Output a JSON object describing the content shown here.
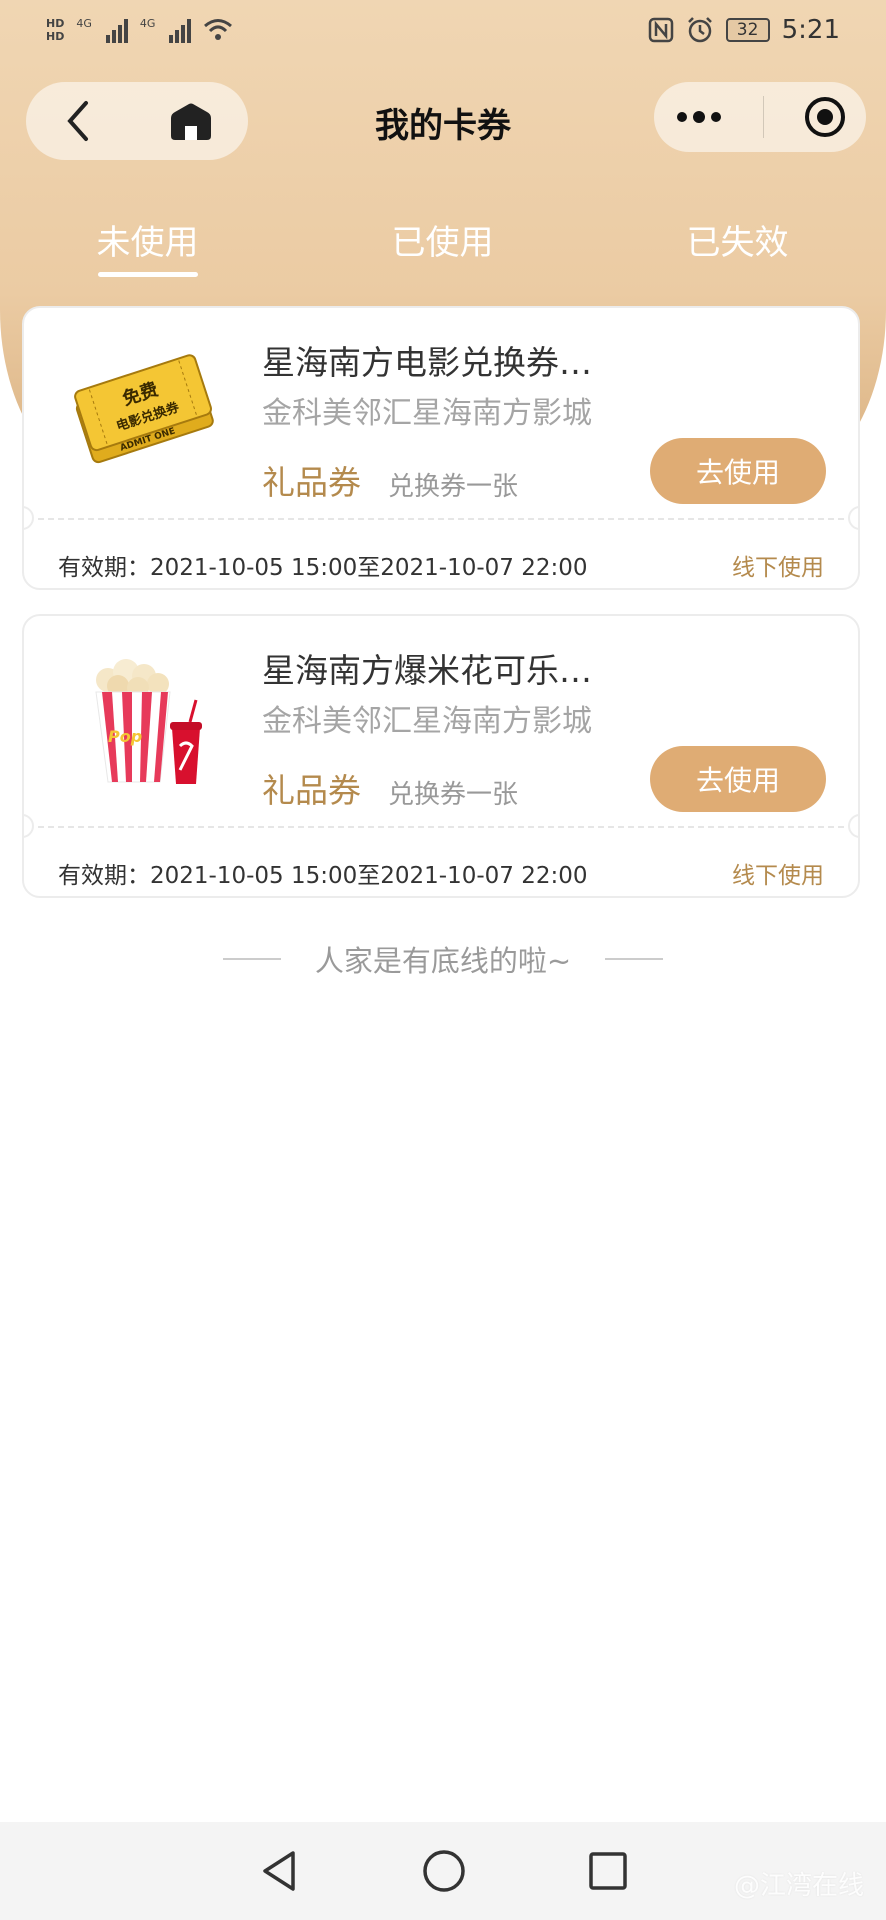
{
  "status_bar": {
    "hd1": "HD",
    "hd2": "HD",
    "net1": "4G",
    "net2": "4G",
    "battery": "32",
    "time": "5:21"
  },
  "nav": {
    "title": "我的卡券",
    "icons": [
      "back-chevron-icon",
      "home-icon",
      "more-dots-icon",
      "close-circle-icon"
    ]
  },
  "tabs": [
    {
      "label": "未使用",
      "active": true
    },
    {
      "label": "已使用",
      "active": false
    },
    {
      "label": "已失效",
      "active": false
    }
  ],
  "cards": [
    {
      "title": "星海南方电影兑换券…",
      "venue": "金科美邻汇星海南方影城",
      "type": "礼品券",
      "subtitle": "兑换券一张",
      "button": "去使用",
      "validity": "有效期：2021-10-05 15:00至2021-10-07 22:00",
      "usage": "线下使用",
      "thumb_text": [
        "免费",
        "电影兑换券",
        "ADMIT ONE"
      ]
    },
    {
      "title": "星海南方爆米花可乐…",
      "venue": "金科美邻汇星海南方影城",
      "type": "礼品券",
      "subtitle": "兑换券一张",
      "button": "去使用",
      "validity": "有效期：2021-10-05 15:00至2021-10-07 22:00",
      "usage": "线下使用"
    }
  ],
  "end_text": "人家是有底线的啦~",
  "watermark": "@江湾在线",
  "colors": {
    "header_top": "#f0d6b3",
    "accent": "#dfac74",
    "gold_text": "#b48a4d"
  }
}
